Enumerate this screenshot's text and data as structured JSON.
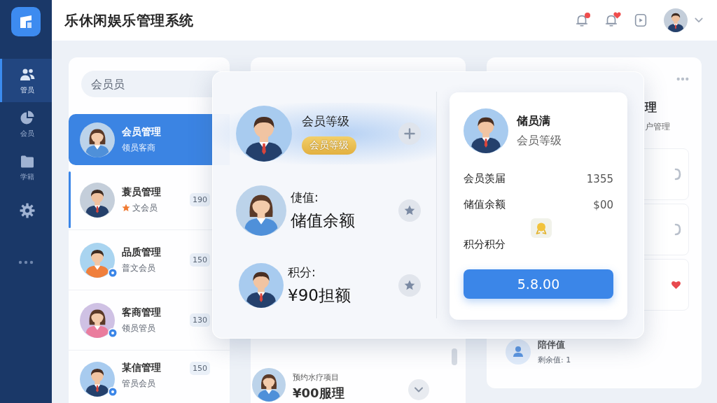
{
  "header": {
    "title": "乐休闲娱乐管理系统",
    "icons": [
      {
        "badge": true
      },
      {
        "badge": true
      },
      {
        "badge": false
      }
    ]
  },
  "sidebar": {
    "items": [
      {
        "label": "管员",
        "selected": true
      },
      {
        "label": "会员",
        "selected": false
      },
      {
        "label": "学籍",
        "selected": false
      },
      {
        "selected": false
      }
    ]
  },
  "member_list": {
    "search": {
      "placeholder": "会员员"
    },
    "items": [
      {
        "title": "会员管理",
        "subtitle": "领员客商",
        "selected": true,
        "highlighted": false,
        "vip": false,
        "verified": false
      },
      {
        "title": "蓑员管理",
        "subtitle": "文会员",
        "count": "190",
        "selected": false,
        "highlighted": true,
        "vip": true,
        "verified": false
      },
      {
        "title": "品质管理",
        "subtitle": "普文会员",
        "count": "150",
        "selected": false,
        "highlighted": false,
        "vip": false,
        "verified": true
      },
      {
        "title": "客商管理",
        "subtitle": "领员管员",
        "count": "130",
        "selected": false,
        "highlighted": false,
        "vip": false,
        "verified": true
      },
      {
        "title": "某信管理",
        "subtitle": "管员会员",
        "count": "150",
        "selected": false,
        "highlighted": false,
        "vip": false,
        "verified": true
      }
    ]
  },
  "services": {
    "items": [
      {
        "subtitle": "预约水疗项目",
        "title": "¥00服理"
      }
    ]
  },
  "overview": {
    "title": "理",
    "subtitle": "户管理",
    "cards": [
      {
        "liked": false
      },
      {
        "liked": false
      },
      {
        "liked": true
      }
    ],
    "footer": {
      "title": "陪伴值",
      "subtitle": "剩余值: 1"
    }
  },
  "modal": {
    "rows": [
      {
        "kind": "badge",
        "title": "会员等级",
        "badge": "会员等级",
        "selected": true
      },
      {
        "kind": "value",
        "label": "倢值:",
        "value": "储值余额",
        "selected": false
      },
      {
        "kind": "value",
        "label": "积分:",
        "value": "¥90担额",
        "selected": false
      }
    ],
    "detail": {
      "name": "储员满",
      "subtitle": "会员等级",
      "stats": [
        {
          "label": "会员羡届",
          "value": "1355"
        },
        {
          "label": "储值余额",
          "value": "$00"
        }
      ],
      "points_label": "积分积分",
      "button": "5.8.00"
    }
  }
}
